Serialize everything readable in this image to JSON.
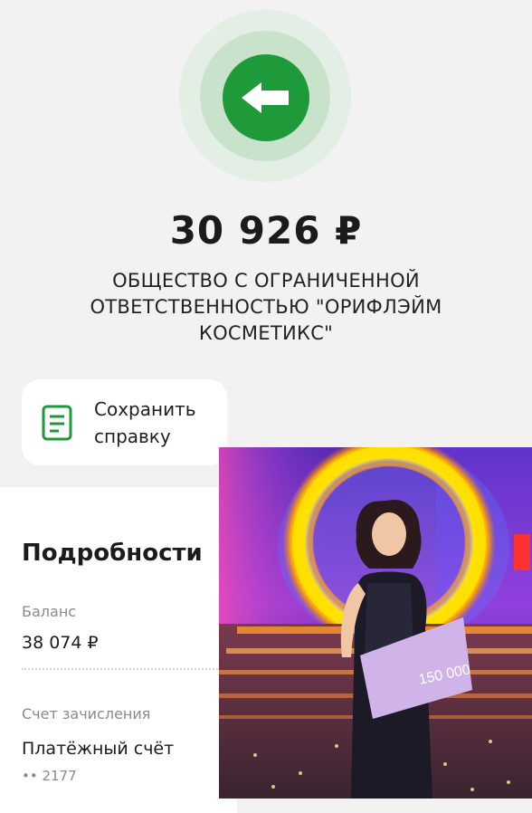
{
  "transfer": {
    "direction_icon": "arrow-left-icon",
    "amount": "30 926 ₽",
    "payee_line1": "ОБЩЕСТВО С ОГРАНИЧЕННОЙ",
    "payee_line2": "ОТВЕТСТВЕННОСТЬЮ \"ОРИФЛЭЙМ",
    "payee_line3": "КОСМЕТИКС\""
  },
  "save_receipt": {
    "icon": "document-icon",
    "line1": "Сохранить",
    "line2": "справку"
  },
  "details": {
    "title": "Подробности",
    "balance_label": "Баланс",
    "balance_value": "38 074 ₽",
    "account_label": "Счет зачисления",
    "account_value": "Платёжный счёт",
    "account_mask": "•• 2177"
  },
  "photo_overlay": {
    "sign_amount": "150 000"
  },
  "colors": {
    "accent": "#1f9a3a",
    "halo_outer": "#e3eee4",
    "halo_inner": "#c9e2cb",
    "background": "#f2f2f2"
  }
}
